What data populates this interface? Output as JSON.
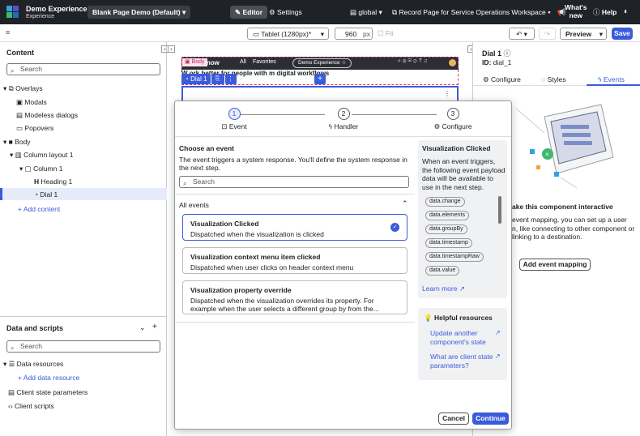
{
  "topbar": {
    "app_name": "Demo Experience",
    "app_sub": "Experience",
    "page_select": "Blank Page Demo (Default)",
    "editor": "Editor",
    "settings": "Settings",
    "scope": "global",
    "record_page": "Record Page for Service Operations Workspace",
    "whats_new_1": "What's",
    "whats_new_2": "new",
    "help": "Help"
  },
  "toolbar": {
    "device": "Tablet (1280px)*",
    "width_value": "960",
    "width_unit": "px",
    "fit": "Fit",
    "preview": "Preview",
    "save": "Save"
  },
  "content_panel": {
    "title": "Content",
    "search_placeholder": "Search",
    "tree": [
      {
        "label": "Overlays"
      },
      {
        "label": "Modals"
      },
      {
        "label": "Modeless dialogs"
      },
      {
        "label": "Popovers"
      },
      {
        "label": "Body"
      },
      {
        "label": "Column layout 1"
      },
      {
        "label": "Column 1"
      },
      {
        "label": "Heading 1"
      },
      {
        "label": "Dial 1"
      }
    ],
    "add_content": "Add content"
  },
  "data_panel": {
    "title": "Data and scripts",
    "search_placeholder": "Search",
    "data_resources": "Data resources",
    "add_data_resource": "Add data resource",
    "client_state": "Client state parameters",
    "client_scripts": "Client scripts"
  },
  "canvas": {
    "body_tag": "Body",
    "dial_tag": "Dial 1",
    "nav_brand": "cenow",
    "nav_all": "All",
    "nav_favorites": "Favorites",
    "nav_pill": "Demo Experience",
    "heading_text": "W         ork better for people with m        digital workflows"
  },
  "modal": {
    "steps": [
      {
        "num": "1",
        "label": "Event"
      },
      {
        "num": "2",
        "label": "Handler"
      },
      {
        "num": "3",
        "label": "Configure"
      }
    ],
    "choose_title": "Choose an event",
    "choose_desc": "The event triggers a system response. You'll define the system response in the next step.",
    "search_placeholder": "Search",
    "all_events": "All events",
    "events": [
      {
        "title": "Visualization Clicked",
        "desc": "Dispatched when the visualization is clicked"
      },
      {
        "title": "Visualization context menu item clicked",
        "desc": "Dispatched when user clicks on header context menu"
      },
      {
        "title": "Visualization property override",
        "desc": "Dispatched when the visualization overrides its property. For example when the user selects a different group by from the..."
      }
    ],
    "info_title": "Visualization Clicked",
    "info_desc": "When an event triggers, the following event payload data will be available to use in the next step.",
    "payload": [
      "data.change",
      "data.elements",
      "data.groupBy",
      "data.timestamp",
      "data.timestampRaw",
      "data.value"
    ],
    "learn_more": "Learn more",
    "helpful_title": "Helpful resources",
    "link1": "Update another component's state",
    "link2": "What are client state parameters?",
    "cancel": "Cancel",
    "continue": "Continue"
  },
  "right_panel": {
    "title": "Dial 1",
    "id_label": "ID:",
    "id_value": "dial_1",
    "tabs": [
      "Configure",
      "Styles",
      "Events"
    ],
    "interactive_title": "ake this component interactive",
    "interactive_l1": "event mapping, you can set up a user",
    "interactive_l2": "n, like connecting to other component or",
    "interactive_l3": "linking to a destination.",
    "add_event_mapping": "Add event mapping"
  },
  "colors": {
    "accent": "#3b5bdb",
    "topbar": "#1f2328",
    "selection": "#e6ebfa"
  }
}
